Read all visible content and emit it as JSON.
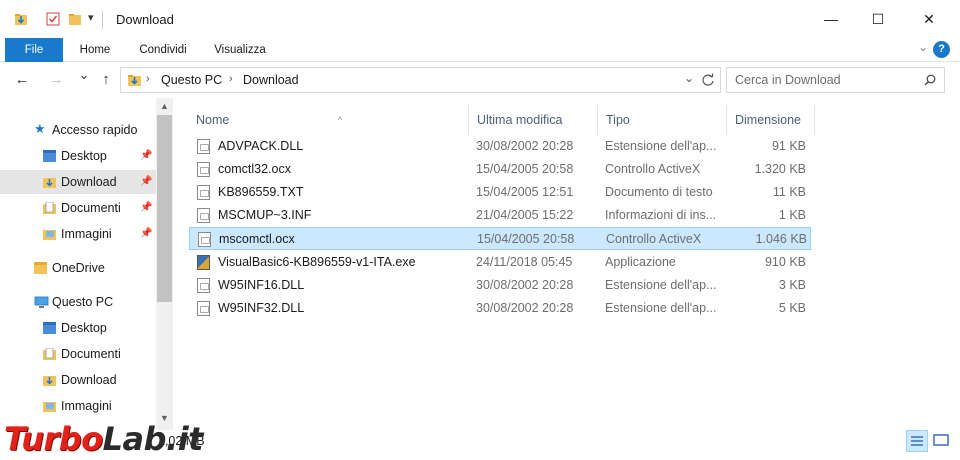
{
  "window": {
    "title": "Download",
    "quick_access_dropdown": "▾",
    "minimize": "—",
    "maximize": "☐",
    "close": "✕"
  },
  "ribbon": {
    "tabs": [
      "File",
      "Home",
      "Condividi",
      "Visualizza"
    ],
    "accent_color": "#1979ca",
    "help": "?"
  },
  "navigation": {
    "back": "←",
    "forward": "→",
    "recent": "⌄",
    "up": "↑",
    "address_crumbs": [
      "Questo PC",
      "Download"
    ],
    "search_placeholder": "Cerca in Download"
  },
  "nav_pane": {
    "items": [
      {
        "label": "Accesso rapido",
        "icon": "star-icon",
        "pinned": false,
        "selected": false
      },
      {
        "label": "Desktop",
        "icon": "folder-icon",
        "pinned": true,
        "selected": false
      },
      {
        "label": "Download",
        "icon": "download-folder-icon",
        "pinned": true,
        "selected": true
      },
      {
        "label": "Documenti",
        "icon": "documents-folder-icon",
        "pinned": true,
        "selected": false
      },
      {
        "label": "Immagini",
        "icon": "pictures-folder-icon",
        "pinned": true,
        "selected": false
      },
      {
        "label": "OneDrive",
        "icon": "folder-icon",
        "pinned": false,
        "selected": false
      },
      {
        "label": "Questo PC",
        "icon": "computer-icon",
        "pinned": false,
        "selected": false
      },
      {
        "label": "Desktop",
        "icon": "folder-icon",
        "pinned": false,
        "selected": false
      },
      {
        "label": "Documenti",
        "icon": "documents-folder-icon",
        "pinned": false,
        "selected": false
      },
      {
        "label": "Download",
        "icon": "download-folder-icon",
        "pinned": false,
        "selected": false
      },
      {
        "label": "Immagini",
        "icon": "pictures-folder-icon",
        "pinned": false,
        "selected": false
      }
    ]
  },
  "file_list": {
    "columns": [
      "Nome",
      "Ultima modifica",
      "Tipo",
      "Dimensione"
    ],
    "sorted_by": "Nome",
    "rows": [
      {
        "name": "ADVPACK.DLL",
        "modified": "30/08/2002 20:28",
        "type": "Estensione dell'ap...",
        "size": "91 KB",
        "icon": "dll-file-icon",
        "selected": false
      },
      {
        "name": "comctl32.ocx",
        "modified": "15/04/2005 20:58",
        "type": "Controllo ActiveX",
        "size": "1.320 KB",
        "icon": "ocx-file-icon",
        "selected": false
      },
      {
        "name": "KB896559.TXT",
        "modified": "15/04/2005 12:51",
        "type": "Documento di testo",
        "size": "11 KB",
        "icon": "text-file-icon",
        "selected": false
      },
      {
        "name": "MSCMUP~3.INF",
        "modified": "21/04/2005 15:22",
        "type": "Informazioni di ins...",
        "size": "1 KB",
        "icon": "inf-file-icon",
        "selected": false
      },
      {
        "name": "mscomctl.ocx",
        "modified": "15/04/2005 20:58",
        "type": "Controllo ActiveX",
        "size": "1.046 KB",
        "icon": "ocx-file-icon",
        "selected": true
      },
      {
        "name": "VisualBasic6-KB896559-v1-ITA.exe",
        "modified": "24/11/2018 05:45",
        "type": "Applicazione",
        "size": "910 KB",
        "icon": "exe-file-icon",
        "selected": false
      },
      {
        "name": "W95INF16.DLL",
        "modified": "30/08/2002 20:28",
        "type": "Estensione dell'ap...",
        "size": "3 KB",
        "icon": "dll-file-icon",
        "selected": false
      },
      {
        "name": "W95INF32.DLL",
        "modified": "30/08/2002 20:28",
        "type": "Estensione dell'ap...",
        "size": "5 KB",
        "icon": "dll-file-icon",
        "selected": false
      }
    ],
    "selection_color": "#cce8ff"
  },
  "status_bar": {
    "text": "1,02 MB"
  },
  "watermark": {
    "part1": "Turbo",
    "part2": "Lab.it",
    "color": "#e32119"
  }
}
